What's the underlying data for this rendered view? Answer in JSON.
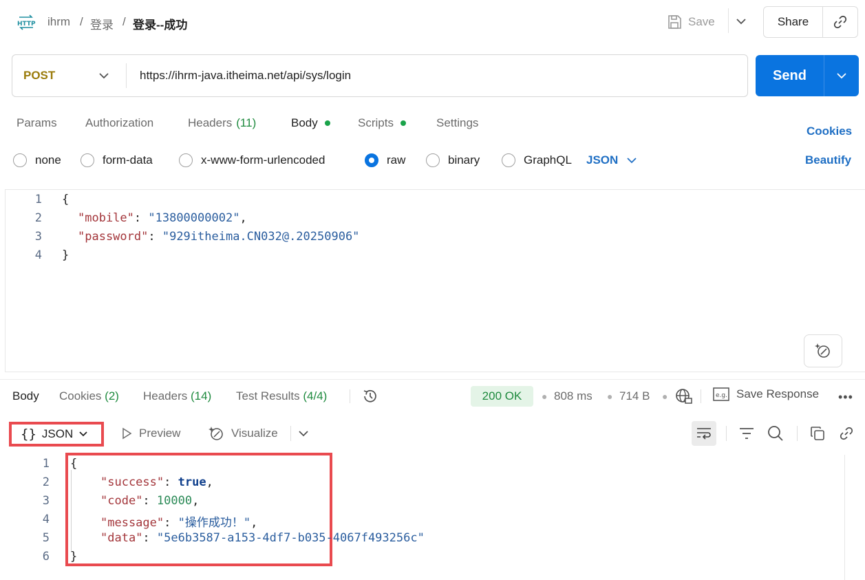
{
  "breadcrumb": {
    "collection": "ihrm",
    "separator": "/",
    "folder": "登录",
    "request": "登录--成功"
  },
  "header": {
    "save_label": "Save",
    "share_label": "Share"
  },
  "request": {
    "method": "POST",
    "url": "https://ihrm-java.itheima.net/api/sys/login",
    "send_label": "Send",
    "tabs": [
      {
        "label": "Params"
      },
      {
        "label": "Authorization"
      },
      {
        "label": "Headers",
        "count": "(11)"
      },
      {
        "label": "Body"
      },
      {
        "label": "Scripts"
      },
      {
        "label": "Settings"
      }
    ],
    "cookies_label": "Cookies",
    "beautify_label": "Beautify",
    "body_types": [
      "none",
      "form-data",
      "x-www-form-urlencoded",
      "raw",
      "binary",
      "GraphQL"
    ],
    "selected_body_type": "raw",
    "language": "JSON",
    "body_lines": [
      "1",
      "2",
      "3",
      "4"
    ],
    "body": {
      "open": "{",
      "key_mobile": "\"mobile\"",
      "val_mobile": "\"13800000002\"",
      "key_password": "\"password\"",
      "val_password": "\"929itheima.CN032@.20250906\"",
      "close": "}"
    }
  },
  "response": {
    "tabs": [
      {
        "label": "Body"
      },
      {
        "label": "Cookies",
        "count": "(2)"
      },
      {
        "label": "Headers",
        "count": "(14)"
      },
      {
        "label": "Test Results",
        "count": "(4/4)"
      }
    ],
    "status": "200 OK",
    "time": "808 ms",
    "size": "714 B",
    "save_response_label": "Save Response",
    "format": "JSON",
    "format_icon": "{}",
    "preview_label": "Preview",
    "visualize_label": "Visualize",
    "body_lines": [
      "1",
      "2",
      "3",
      "4",
      "5",
      "6"
    ],
    "body": {
      "open": "{",
      "key_success": "\"success\"",
      "val_success": "true",
      "key_code": "\"code\"",
      "val_code": "10000",
      "key_message": "\"message\"",
      "val_message": "\"操作成功！\"",
      "key_data": "\"data\"",
      "val_data": "\"5e6b3587-a153-4df7-b035-4067f493256c\"",
      "close": "}"
    }
  },
  "colors": {
    "accent": "#0a74e0",
    "highlight": "#e94a4f",
    "status_ok": "#1e8a3e"
  }
}
